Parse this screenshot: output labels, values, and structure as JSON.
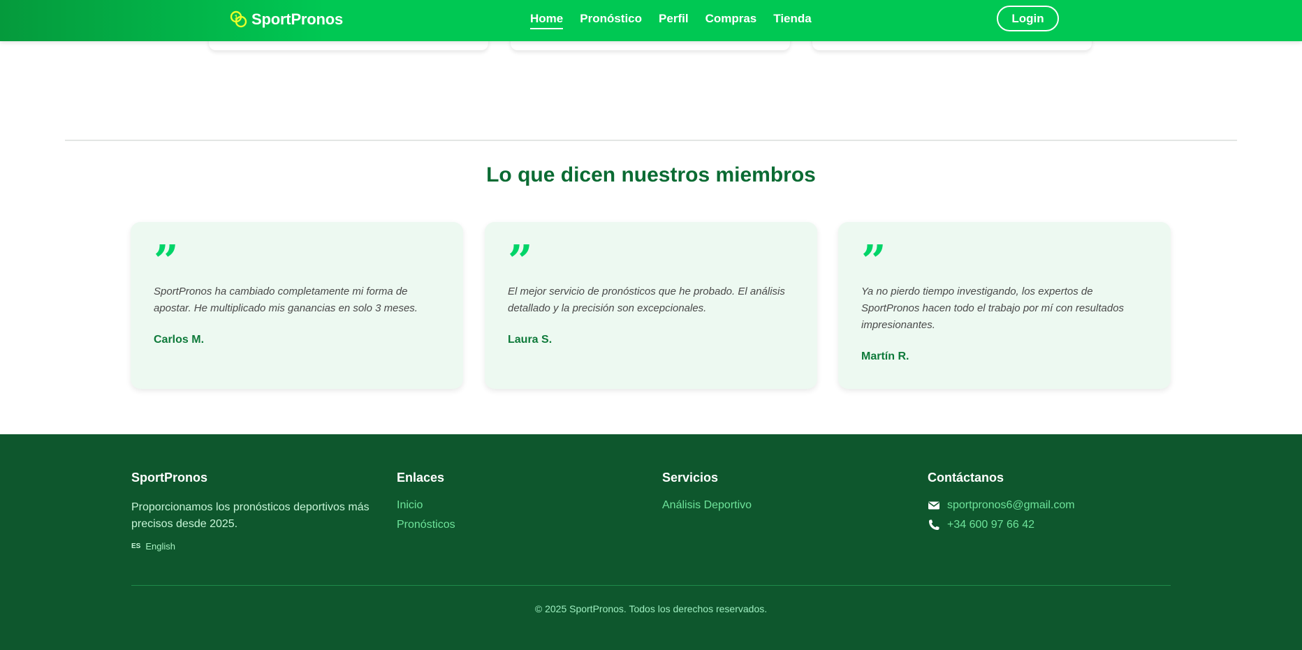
{
  "header": {
    "logo_text": "SportPronos",
    "nav": [
      {
        "label": "Home",
        "active": true
      },
      {
        "label": "Pronóstico",
        "active": false
      },
      {
        "label": "Perfil",
        "active": false
      },
      {
        "label": "Compras",
        "active": false
      },
      {
        "label": "Tienda",
        "active": false
      }
    ],
    "login_label": "Login"
  },
  "testimonials": {
    "title": "Lo que dicen nuestros miembros",
    "quote_glyph": "”",
    "items": [
      {
        "text": "SportPronos ha cambiado completamente mi forma de apostar. He multiplicado mis ganancias en solo 3 meses.",
        "author": "Carlos M."
      },
      {
        "text": "El mejor servicio de pronósticos que he probado. El análisis detallado y la precisión son excepcionales.",
        "author": "Laura S."
      },
      {
        "text": "Ya no pierdo tiempo investigando, los expertos de SportPronos hacen todo el trabajo por mí con resultados impresionantes.",
        "author": "Martín R."
      }
    ]
  },
  "footer": {
    "brand": {
      "title": "SportPronos",
      "description": "Proporcionamos los pronósticos deportivos más precisos desde 2025.",
      "lang_code": "ES",
      "lang_label": "English"
    },
    "links": {
      "title": "Enlaces",
      "items": [
        "Inicio",
        "Pronósticos"
      ]
    },
    "services": {
      "title": "Servicios",
      "items": [
        "Análisis Deportivo"
      ]
    },
    "contact": {
      "title": "Contáctanos",
      "email": "sportpronos6@gmail.com",
      "phone": "+34 600 97 66 42"
    },
    "copyright": "© 2025 SportPronos. Todos los derechos reservados."
  },
  "colors": {
    "header_green": "#00c853",
    "title_green": "#0b6b33",
    "card_bg": "#edf9f1",
    "quote_green": "#00d468",
    "footer_bg": "#0e572d",
    "footer_link": "#6ee39a"
  },
  "icons": {
    "logo": "coins-icon",
    "email": "envelope-icon",
    "phone": "phone-icon"
  }
}
